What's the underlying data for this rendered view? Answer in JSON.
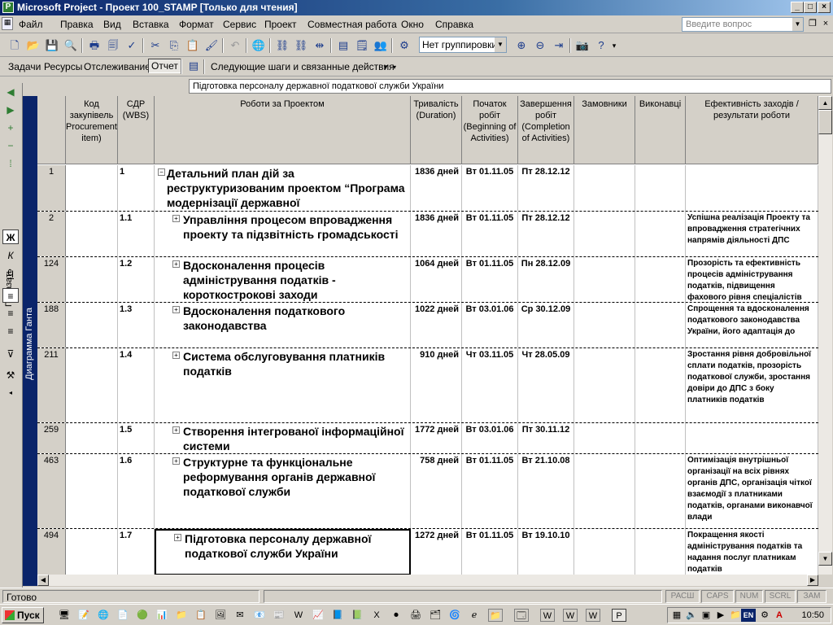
{
  "window": {
    "title": "Microsoft Project - Проект 100_STAMP [Только для чтения]",
    "app_icon": "project-icon"
  },
  "menu": [
    "Файл",
    "Правка",
    "Вид",
    "Вставка",
    "Формат",
    "Сервис",
    "Проект",
    "Совместная работа",
    "Окно",
    "Справка"
  ],
  "ask_question_placeholder": "Введите вопрос",
  "toolbar": {
    "grouping_value": "Нет группировки"
  },
  "guide_toolbar": {
    "tasks": "Задачи",
    "resources": "Ресурсы",
    "tracking": "Отслеживание",
    "report": "Отчет",
    "next_steps": "Следующие шаги и связанные действия"
  },
  "entry_bar_value": "Підготовка персоналу державної податкової служби України",
  "left_panel": {
    "show_label": "Показать"
  },
  "view_bar_label": "Диаграмма Ганта",
  "columns": {
    "procurement_code": "Код закупівель Procurement item)",
    "wbs": "СДР (WBS)",
    "name": "Роботи за Проектом",
    "duration": "Тривалість (Duration)",
    "start": "Початок робіт (Beginning of Activities)",
    "finish": "Завершення робіт (Completion of Activities)",
    "customers": "Замовники",
    "executors": "Виконавці",
    "effectiveness": "Ефективність заходів / результати роботи"
  },
  "rows": [
    {
      "id": "1",
      "wbs": "1",
      "name": "Детальний план дій за реструктуризованим проектом “Програма модернізації державної",
      "duration": "1836 дней",
      "start": "Вт 01.11.05",
      "finish": "Пт 28.12.12",
      "effect": ""
    },
    {
      "id": "2",
      "wbs": "1.1",
      "name": "Управління процесом впровадження проекту та підзвітність громадськості",
      "duration": "1836 дней",
      "start": "Вт 01.11.05",
      "finish": "Пт 28.12.12",
      "effect": "Успішна реалізація Проекту та впровадження стратегічних напрямів діяльності ДПС"
    },
    {
      "id": "124",
      "wbs": "1.2",
      "name": "Вдосконалення процесів адміністрування податків - короткострокові заходи",
      "duration": "1064 дней",
      "start": "Вт 01.11.05",
      "finish": "Пн 28.12.09",
      "effect": "Прозорість та ефективність процесів адміністрування податків, підвищення фахового рівня спеціалістів"
    },
    {
      "id": "188",
      "wbs": "1.3",
      "name": "Вдосконалення податкового законодавства",
      "duration": "1022 дней",
      "start": "Вт 03.01.06",
      "finish": "Ср 30.12.09",
      "effect": "Спрощення та вдосконалення податкового законодавства України, його адаптація до"
    },
    {
      "id": "211",
      "wbs": "1.4",
      "name": "Система обслуговування платників податків",
      "duration": "910 дней",
      "start": "Чт 03.11.05",
      "finish": "Чт 28.05.09",
      "effect": "Зростання рівня добровільної сплати податків, прозорість податкової служби, зростання довіри до ДПС з боку платників податків"
    },
    {
      "id": "259",
      "wbs": "1.5",
      "name": "Створення інтегрованої інформаційної системи",
      "duration": "1772 дней",
      "start": "Вт 03.01.06",
      "finish": "Пт 30.11.12",
      "effect": ""
    },
    {
      "id": "463",
      "wbs": "1.6",
      "name": "Структурне та функціональне реформування органів державної податкової служби",
      "duration": "758 дней",
      "start": "Вт 01.11.05",
      "finish": "Вт 21.10.08",
      "effect": "Оптимізація внутрішньої організації на всіх рівнях органів ДПС, організація чіткої взаємодії з платниками податків, органами виконавчої влади"
    },
    {
      "id": "494",
      "wbs": "1.7",
      "name": "Підготовка персоналу державної податкової служби України",
      "duration": "1272 дней",
      "start": "Вт 01.11.05",
      "finish": "Вт 19.10.10",
      "effect": "Покращення якості адміністрування податків та надання послуг платникам податків"
    }
  ],
  "status": {
    "text": "Готово",
    "indicators": [
      "РАСШ",
      "CAPS",
      "NUM",
      "SCRL",
      "ЗАМ"
    ]
  },
  "taskbar": {
    "start_label": "Пуск",
    "lang": "EN",
    "clock": "10:50"
  }
}
